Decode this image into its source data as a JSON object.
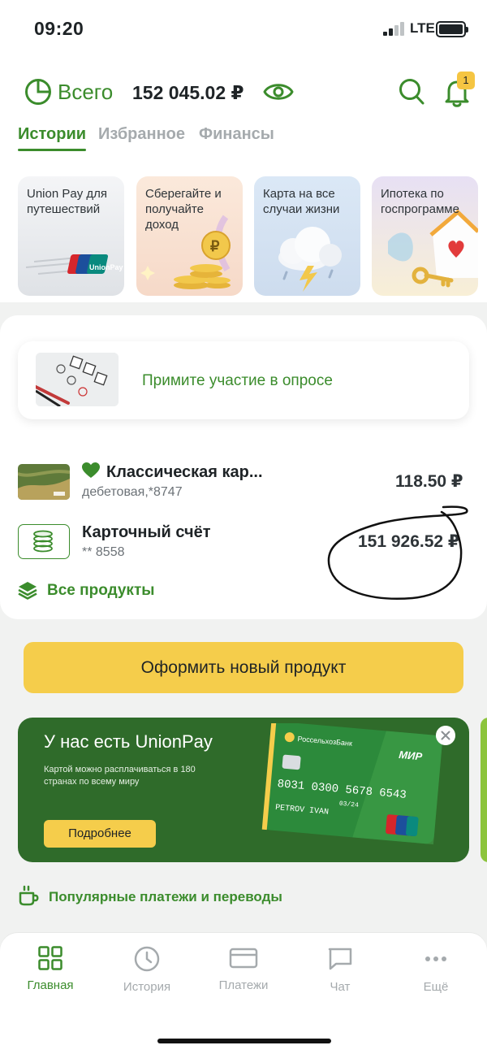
{
  "status_bar": {
    "time": "09:20",
    "network": "LTE"
  },
  "header": {
    "total_label": "Всего",
    "total_amount": "152 045.02 ₽",
    "notifications_count": "1"
  },
  "tabs": [
    {
      "label": "Истории",
      "active": true
    },
    {
      "label": "Избранное",
      "active": false
    },
    {
      "label": "Финансы",
      "active": false
    }
  ],
  "stories": [
    {
      "title": "Union Pay для путешествий"
    },
    {
      "title": "Сберегайте и получайте доход"
    },
    {
      "title": "Карта на все случаи жизни"
    },
    {
      "title": "Ипотека по госпрограмме"
    }
  ],
  "survey": {
    "text": "Примите участие в опросе"
  },
  "products": [
    {
      "name": "Классическая кар...",
      "subtitle": "дебетовая,*8747",
      "amount": "118.50 ₽",
      "favorite": true
    },
    {
      "name": "Карточный счёт",
      "subtitle": "** 8558",
      "amount": "151 926.52 ₽",
      "favorite": false
    }
  ],
  "all_products_label": "Все продукты",
  "new_product_button": "Оформить новый продукт",
  "banner": {
    "title": "У нас есть UnionPay",
    "text": "Картой можно расплачиваться в 180 странах по всему миру",
    "button": "Подробнее",
    "card": {
      "bank": "РоссельхозБанк",
      "brand": "МИР",
      "number": "8031 0300 5678 6543",
      "expiry": "03/24",
      "holder": "PETROV IVAN",
      "network": "UnionPay"
    }
  },
  "popular_label": "Популярные платежи и переводы",
  "bottom_nav": [
    {
      "label": "Главная",
      "icon": "grid-icon",
      "active": true
    },
    {
      "label": "История",
      "icon": "clock-icon",
      "active": false
    },
    {
      "label": "Платежи",
      "icon": "card-icon",
      "active": false
    },
    {
      "label": "Чат",
      "icon": "chat-icon",
      "active": false
    },
    {
      "label": "Ещё",
      "icon": "more-icon",
      "active": false
    }
  ],
  "colors": {
    "accent": "#3b8c2c",
    "button_yellow": "#f5cd4b",
    "banner_green": "#2f6b2a",
    "muted": "#a5aaad"
  }
}
